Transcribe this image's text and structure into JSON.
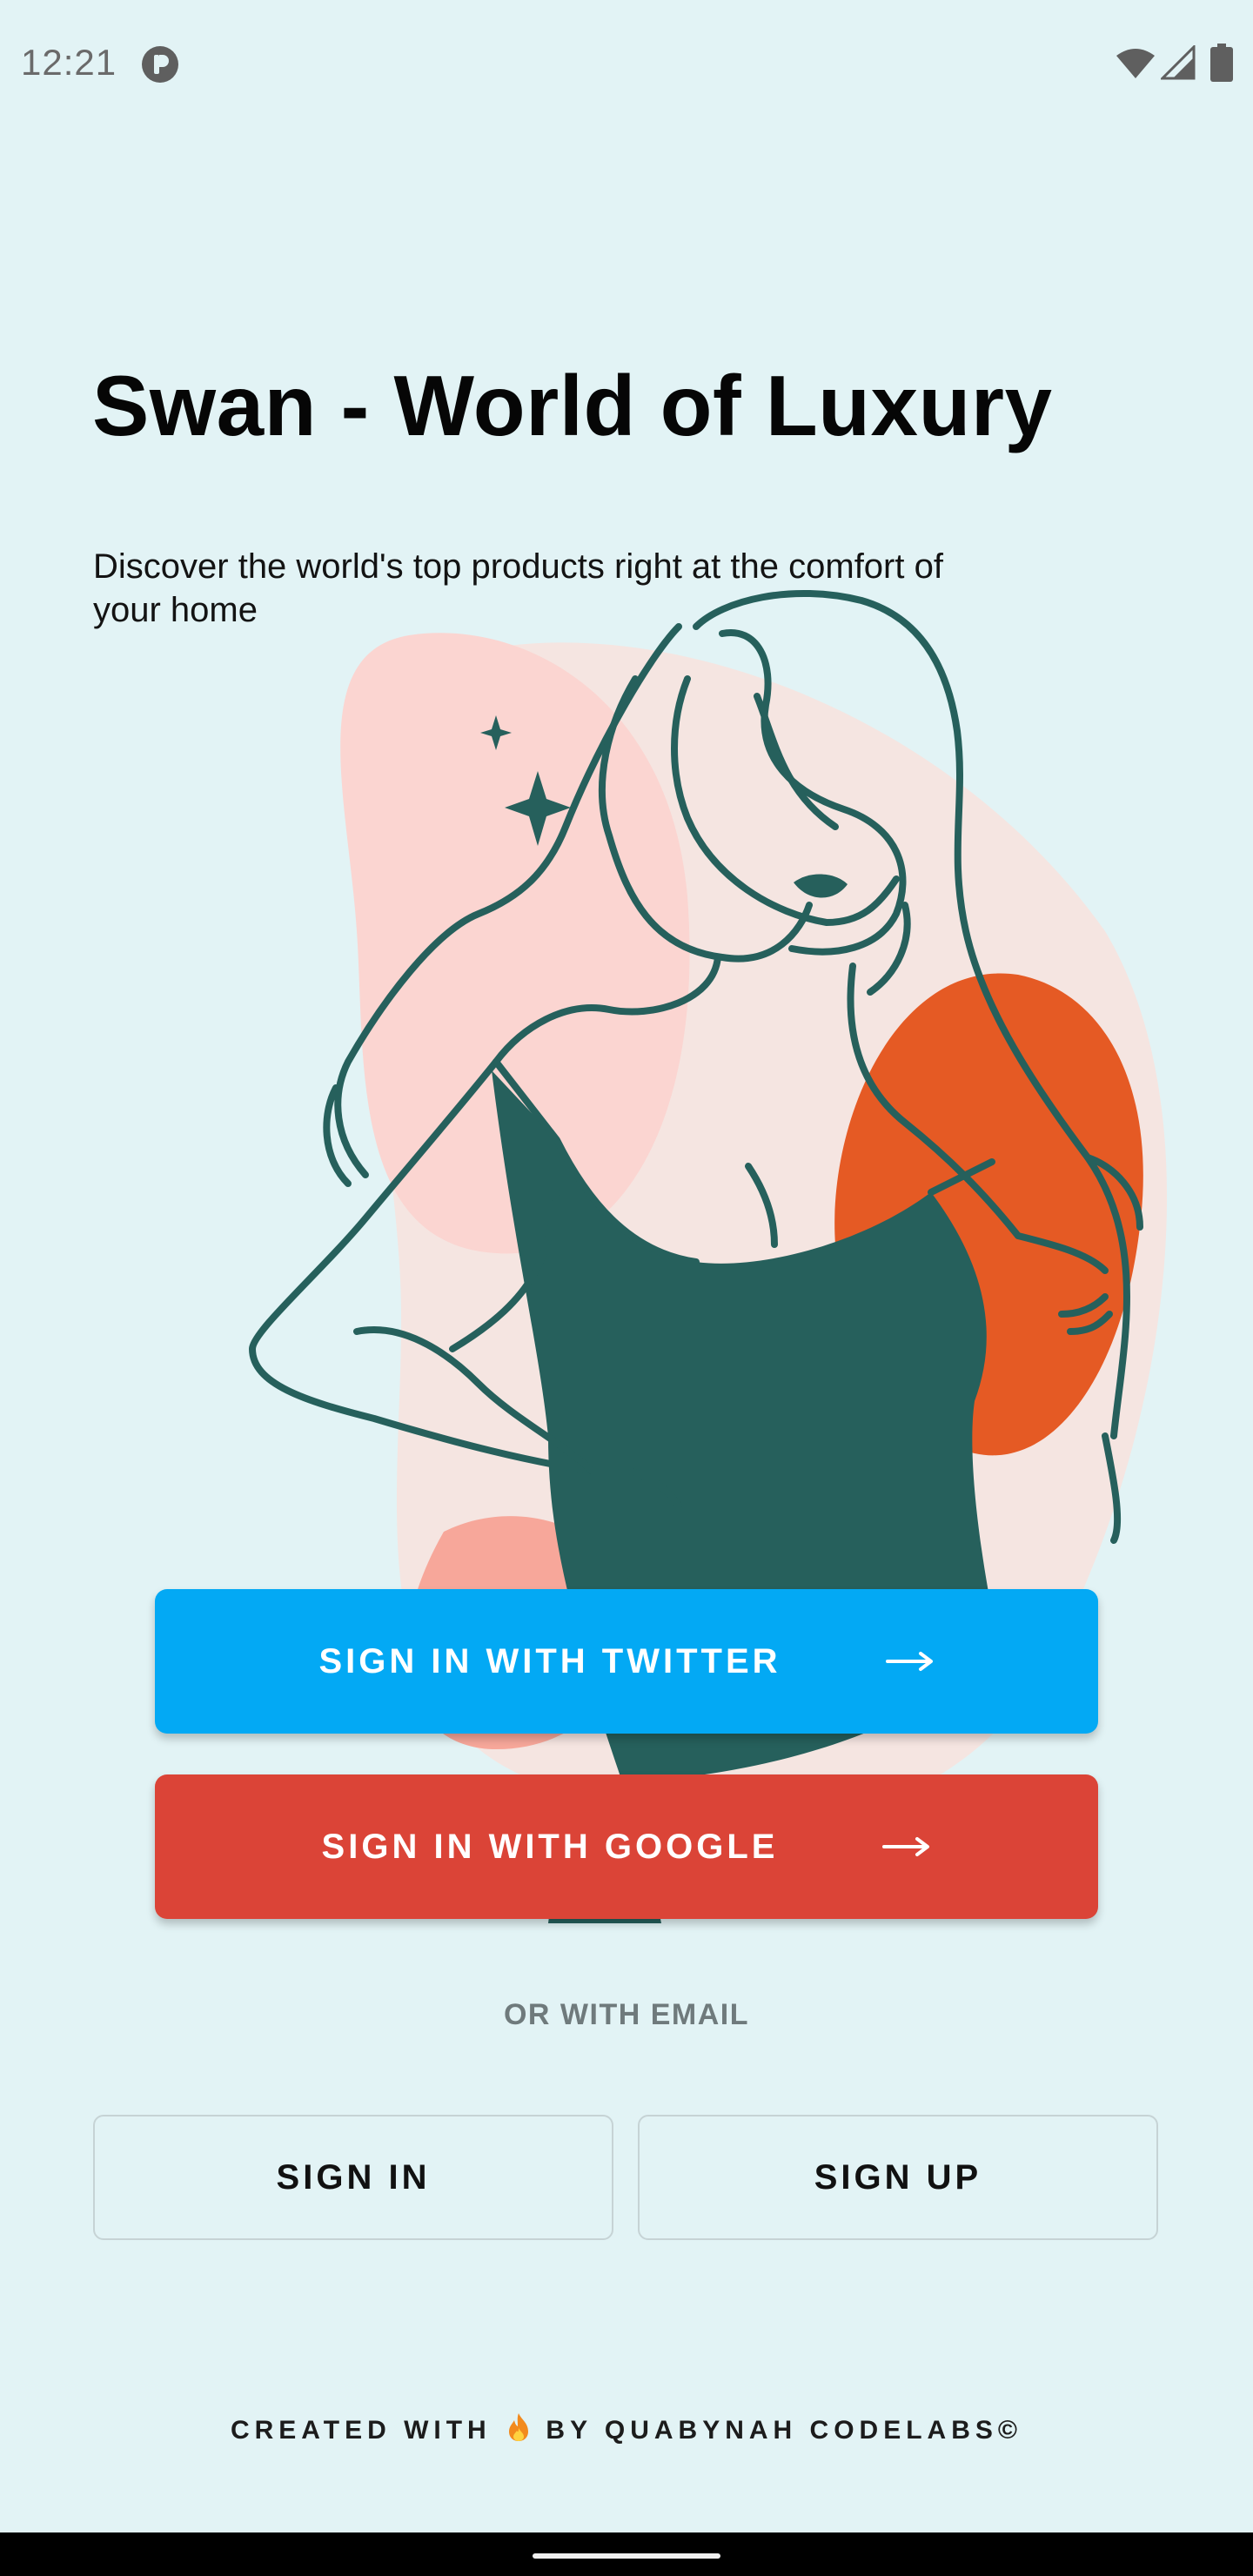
{
  "status_bar": {
    "time": "12:21",
    "icons": [
      "app-notification-icon",
      "wifi-icon",
      "cell-signal-icon",
      "battery-icon"
    ]
  },
  "header": {
    "title": "Swan - World of Luxury",
    "subtitle": "Discover the world's top products right at the comfort of your home"
  },
  "auth": {
    "twitter_label": "SIGN IN WITH TWITTER",
    "google_label": "SIGN IN WITH GOOGLE",
    "divider_label": "OR WITH EMAIL",
    "sign_in_label": "SIGN IN",
    "sign_up_label": "SIGN UP"
  },
  "footer": {
    "prefix": "CREATED WITH",
    "icon": "fire-icon",
    "suffix": "BY QUABYNAH CODELABS©"
  },
  "colors": {
    "background": "#e2f3f5",
    "twitter": "#03a9f4",
    "google": "#db4437",
    "illustration_primary": "#26605c",
    "illustration_accent": "#e55a24",
    "illustration_pink": "#fbd5d1"
  }
}
